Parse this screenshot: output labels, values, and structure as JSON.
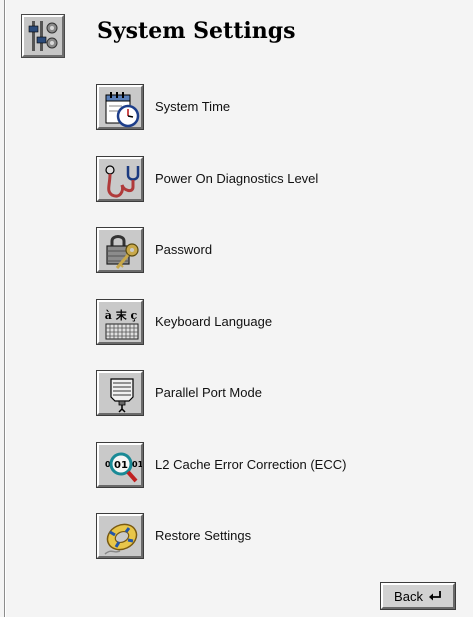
{
  "page": {
    "title": "System Settings"
  },
  "menu": {
    "items": [
      {
        "label": "System Time",
        "icon": "clock-calendar-icon"
      },
      {
        "label": "Power On Diagnostics Level",
        "icon": "stethoscope-icon"
      },
      {
        "label": "Password",
        "icon": "key-lock-icon"
      },
      {
        "label": "Keyboard Language",
        "icon": "keyboard-icon"
      },
      {
        "label": "Parallel Port Mode",
        "icon": "parallel-port-icon"
      },
      {
        "label": "L2 Cache Error Correction (ECC)",
        "icon": "magnifier-binary-icon"
      },
      {
        "label": "Restore Settings",
        "icon": "life-ring-icon"
      }
    ]
  },
  "keyboard_icon_glyphs": "à 末 ç",
  "ecc_icon_text": {
    "left": "0",
    "center": "01",
    "right": "01"
  },
  "footer": {
    "back_label": "Back",
    "back_icon": "enter-arrow-icon"
  },
  "colors": {
    "background": "#f4f4f4",
    "button_face": "#c9c9c9"
  }
}
